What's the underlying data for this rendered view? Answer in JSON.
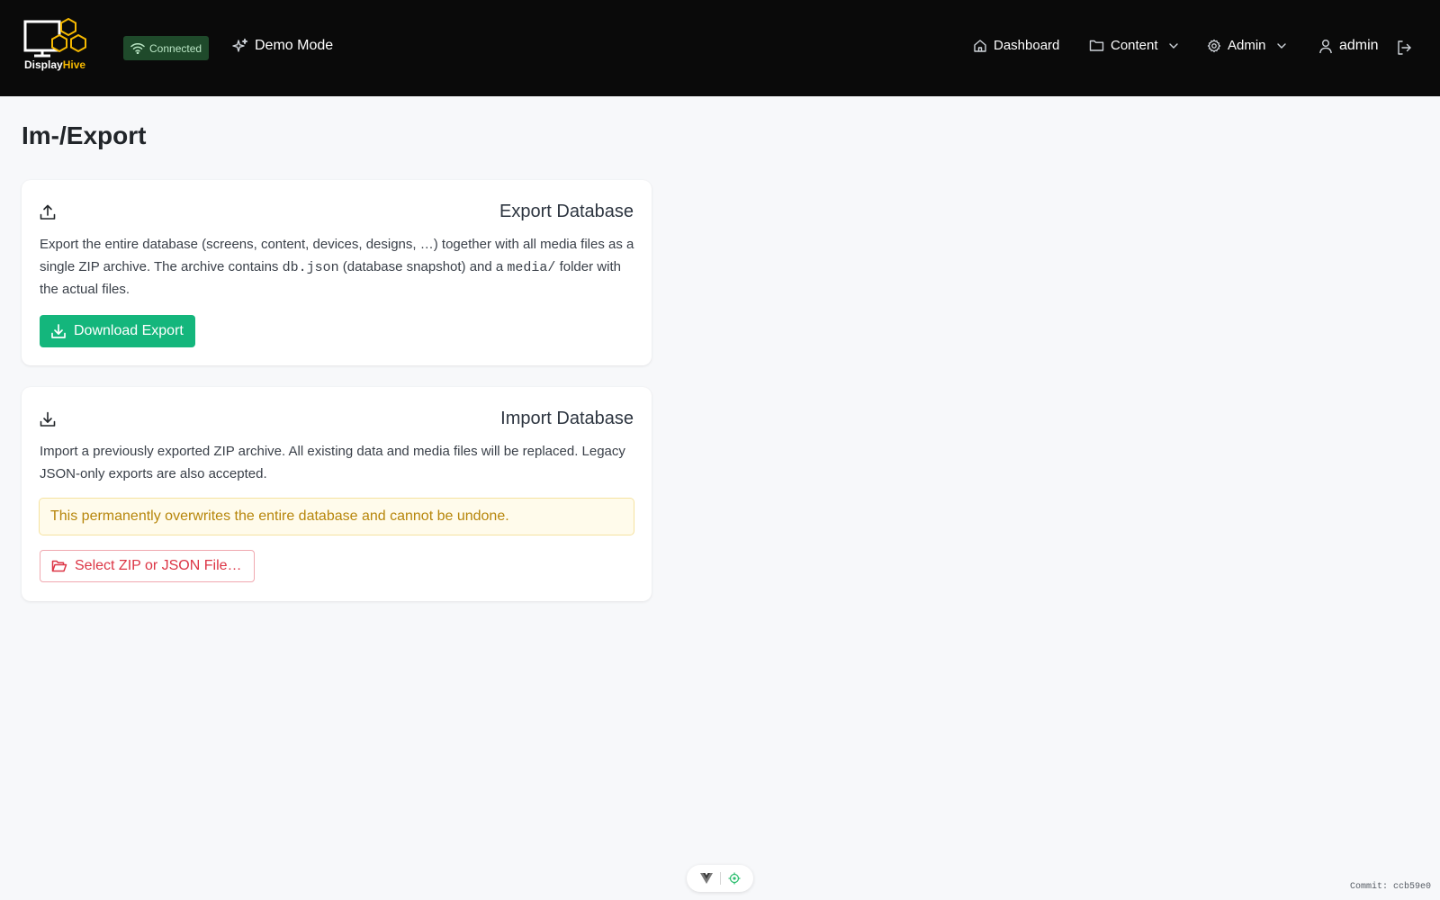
{
  "app": {
    "name_part1": "Display",
    "name_part2": "Hive",
    "brand_color": "#f5b800"
  },
  "header": {
    "connection_status": "Connected",
    "mode_label": "Demo Mode",
    "nav": {
      "dashboard": "Dashboard",
      "content": "Content",
      "admin": "Admin",
      "user": "admin"
    },
    "icons": [
      "wifi-icon",
      "sparkles-icon",
      "home-icon",
      "folder-icon",
      "gear-icon",
      "chevron-down-icon",
      "user-icon",
      "logout-icon"
    ]
  },
  "page": {
    "title": "Im-/Export"
  },
  "export_card": {
    "title": "Export Database",
    "desc_part1": "Export the entire database (screens, content, devices, designs, …) together with all media files as a single ZIP archive. The archive contains ",
    "desc_code1": "db.json",
    "desc_part2": " (database snapshot) and a ",
    "desc_code2": "media/",
    "desc_part3": " folder with the actual files.",
    "button_label": "Download Export",
    "button_color": "#14b67c"
  },
  "import_card": {
    "title": "Import Database",
    "description": "Import a previously exported ZIP archive. All existing data and media files will be replaced. Legacy JSON-only exports are also accepted.",
    "warning": "This permanently overwrites the entire database and cannot be undone.",
    "button_label": "Select ZIP or JSON File…",
    "danger_color": "#dc3545"
  },
  "footer": {
    "commit": "Commit: ccb59e0"
  }
}
